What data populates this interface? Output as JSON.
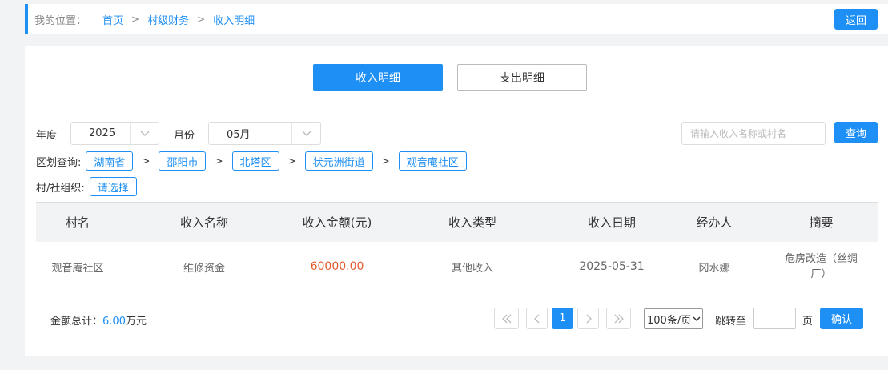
{
  "breadcrumb": {
    "label": "我的位置：",
    "items": [
      "首页",
      "村级财务",
      "收入明细"
    ],
    "separator": ">"
  },
  "back_label": "返回",
  "tabs": [
    {
      "label": "收入明细",
      "active": true
    },
    {
      "label": "支出明细",
      "active": false
    }
  ],
  "filters": {
    "year_label": "年度",
    "year_value": "2025",
    "month_label": "月份",
    "month_value": "05月",
    "search_placeholder": "请输入收入名称或村名",
    "query_label": "查询",
    "region_label": "区划查询:",
    "regions": [
      "湖南省",
      "邵阳市",
      "北塔区",
      "状元洲街道",
      "观音庵社区"
    ],
    "region_separator": ">",
    "org_label": "村/社组织:",
    "org_value": "请选择"
  },
  "table": {
    "headers": [
      "村名",
      "收入名称",
      "收入金额(元)",
      "收入类型",
      "收入日期",
      "经办人",
      "摘要"
    ],
    "rows": [
      {
        "village": "观音庵社区",
        "name": "维修资金",
        "amount": "60000.00",
        "type": "其他收入",
        "date": "2025-05-31",
        "handler": "冈水娜",
        "summary": "危房改造（丝绸厂）"
      }
    ]
  },
  "footer": {
    "total_label": "金额总计：",
    "total_value": "6.00",
    "total_unit": "万元",
    "current_page": "1",
    "page_size": "100条/页",
    "jump_label": "跳转至",
    "page_unit": "页",
    "confirm_label": "确认"
  },
  "colors": {
    "accent": "#1e8ff4",
    "amount": "#e4592c"
  }
}
